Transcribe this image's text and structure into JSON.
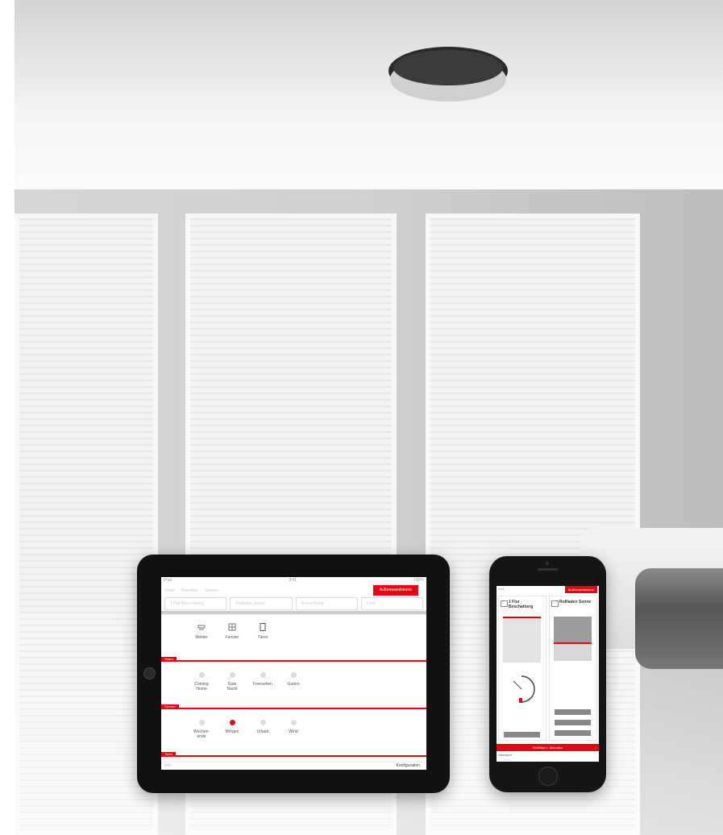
{
  "ipad": {
    "status": {
      "left": "iPad",
      "center": "9:41",
      "right": "100%"
    },
    "nav": [
      "Home",
      "Favoriten",
      "Szenen"
    ],
    "red_button": "Außenwandsirene",
    "rooms": [
      "1 Flur Beschattung",
      "Rollladen Sonne",
      "Beleuchtung",
      "Licht"
    ],
    "sections": [
      {
        "label": "Status",
        "items": [
          "Melder",
          "Fenster",
          "Türen"
        ]
      },
      {
        "label": "Szenen",
        "items": [
          "Coming Home",
          "Gute Nacht",
          "Fernsehen",
          "Garten"
        ]
      },
      {
        "label": "Timer",
        "items": [
          "Wochen-ende",
          "Morgen",
          "Urlaub",
          "Wind"
        ],
        "active_index": 1
      }
    ],
    "footer_right": "Konfiguration",
    "footer_left": "Info"
  },
  "iphone": {
    "status": "9:41",
    "red_button": "Außenwandsirene",
    "col1_title": "1 Flur Beschattung",
    "col2_title": "Rollladen Sonne",
    "col1_button": "Automatik",
    "col2_buttons": [
      "Auf",
      "Stop",
      "Ab"
    ],
    "bar_label": "Rollläden / Jalousien",
    "footer": "Übersicht"
  },
  "colors": {
    "accent": "#e30613"
  }
}
